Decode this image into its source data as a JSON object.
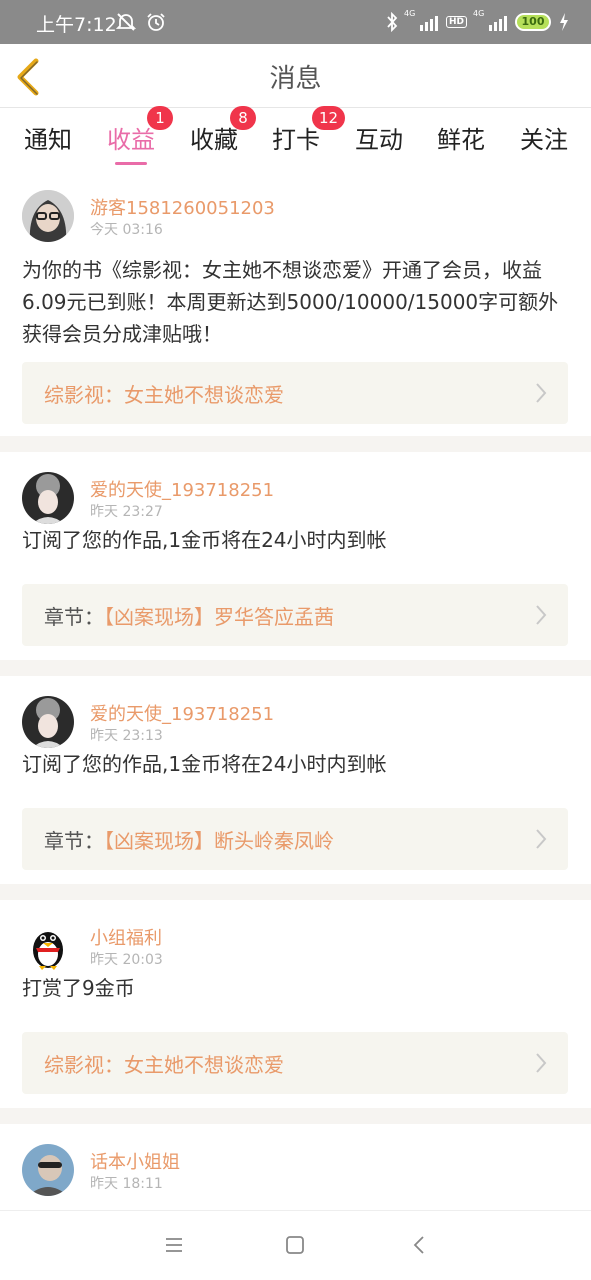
{
  "status_bar": {
    "time": "上午7:12",
    "left_icons": [
      "mute-icon",
      "alarm-icon"
    ],
    "right_icons": [
      "bluetooth-icon",
      "signal-4g-icon",
      "hd-icon",
      "signal-4g-icon",
      "battery-icon",
      "charging-icon"
    ],
    "signal_label": "4G",
    "hd_label": "HD",
    "battery": "100"
  },
  "header": {
    "title": "消息",
    "back_icon": "chevron-left-icon",
    "back_color": "#e6a817"
  },
  "tabs": [
    {
      "label": "通知",
      "badge": ""
    },
    {
      "label": "收益",
      "badge": "1",
      "active": true
    },
    {
      "label": "收藏",
      "badge": "8"
    },
    {
      "label": "打卡",
      "badge": "12"
    },
    {
      "label": "互动",
      "badge": ""
    },
    {
      "label": "鲜花",
      "badge": ""
    },
    {
      "label": "关注",
      "badge": ""
    }
  ],
  "accent_color": "#e96ca8",
  "name_color": "#e99a6a",
  "badge_color": "#f0354b",
  "messages": [
    {
      "username": "游客1581260051203",
      "time": "今天 03:16",
      "avatar": "avatar-photo-icon",
      "text": "为你的书《综影视：女主她不想谈恋爱》开通了会员，收益6.09元已到账！本周更新达到5000/10000/15000字可额外获得会员分成津贴哦！",
      "card_prefix": "",
      "card_text": "综影视：女主她不想谈恋爱"
    },
    {
      "username": "爱的天使_193718251",
      "time": "昨天 23:27",
      "avatar": "avatar-photo-icon",
      "text": "订阅了您的作品,1金币将在24小时内到帐",
      "card_prefix": "章节：",
      "card_text": "【凶案现场】罗华答应孟茜"
    },
    {
      "username": "爱的天使_193718251",
      "time": "昨天 23:13",
      "avatar": "avatar-photo-icon",
      "text": "订阅了您的作品,1金币将在24小时内到帐",
      "card_prefix": "章节：",
      "card_text": "【凶案现场】断头岭秦凤岭"
    },
    {
      "username": "小组福利",
      "time": "昨天 20:03",
      "avatar": "penguin-icon",
      "text": "打赏了9金币",
      "card_prefix": "",
      "card_text": "综影视：女主她不想谈恋爱"
    },
    {
      "username": "话本小姐姐",
      "time": "昨天 18:11",
      "avatar": "avatar-photo-icon",
      "text": "",
      "card_prefix": "",
      "card_text": ""
    }
  ],
  "nav_bar": [
    "menu-icon",
    "home-square-icon",
    "back-triangle-icon"
  ]
}
